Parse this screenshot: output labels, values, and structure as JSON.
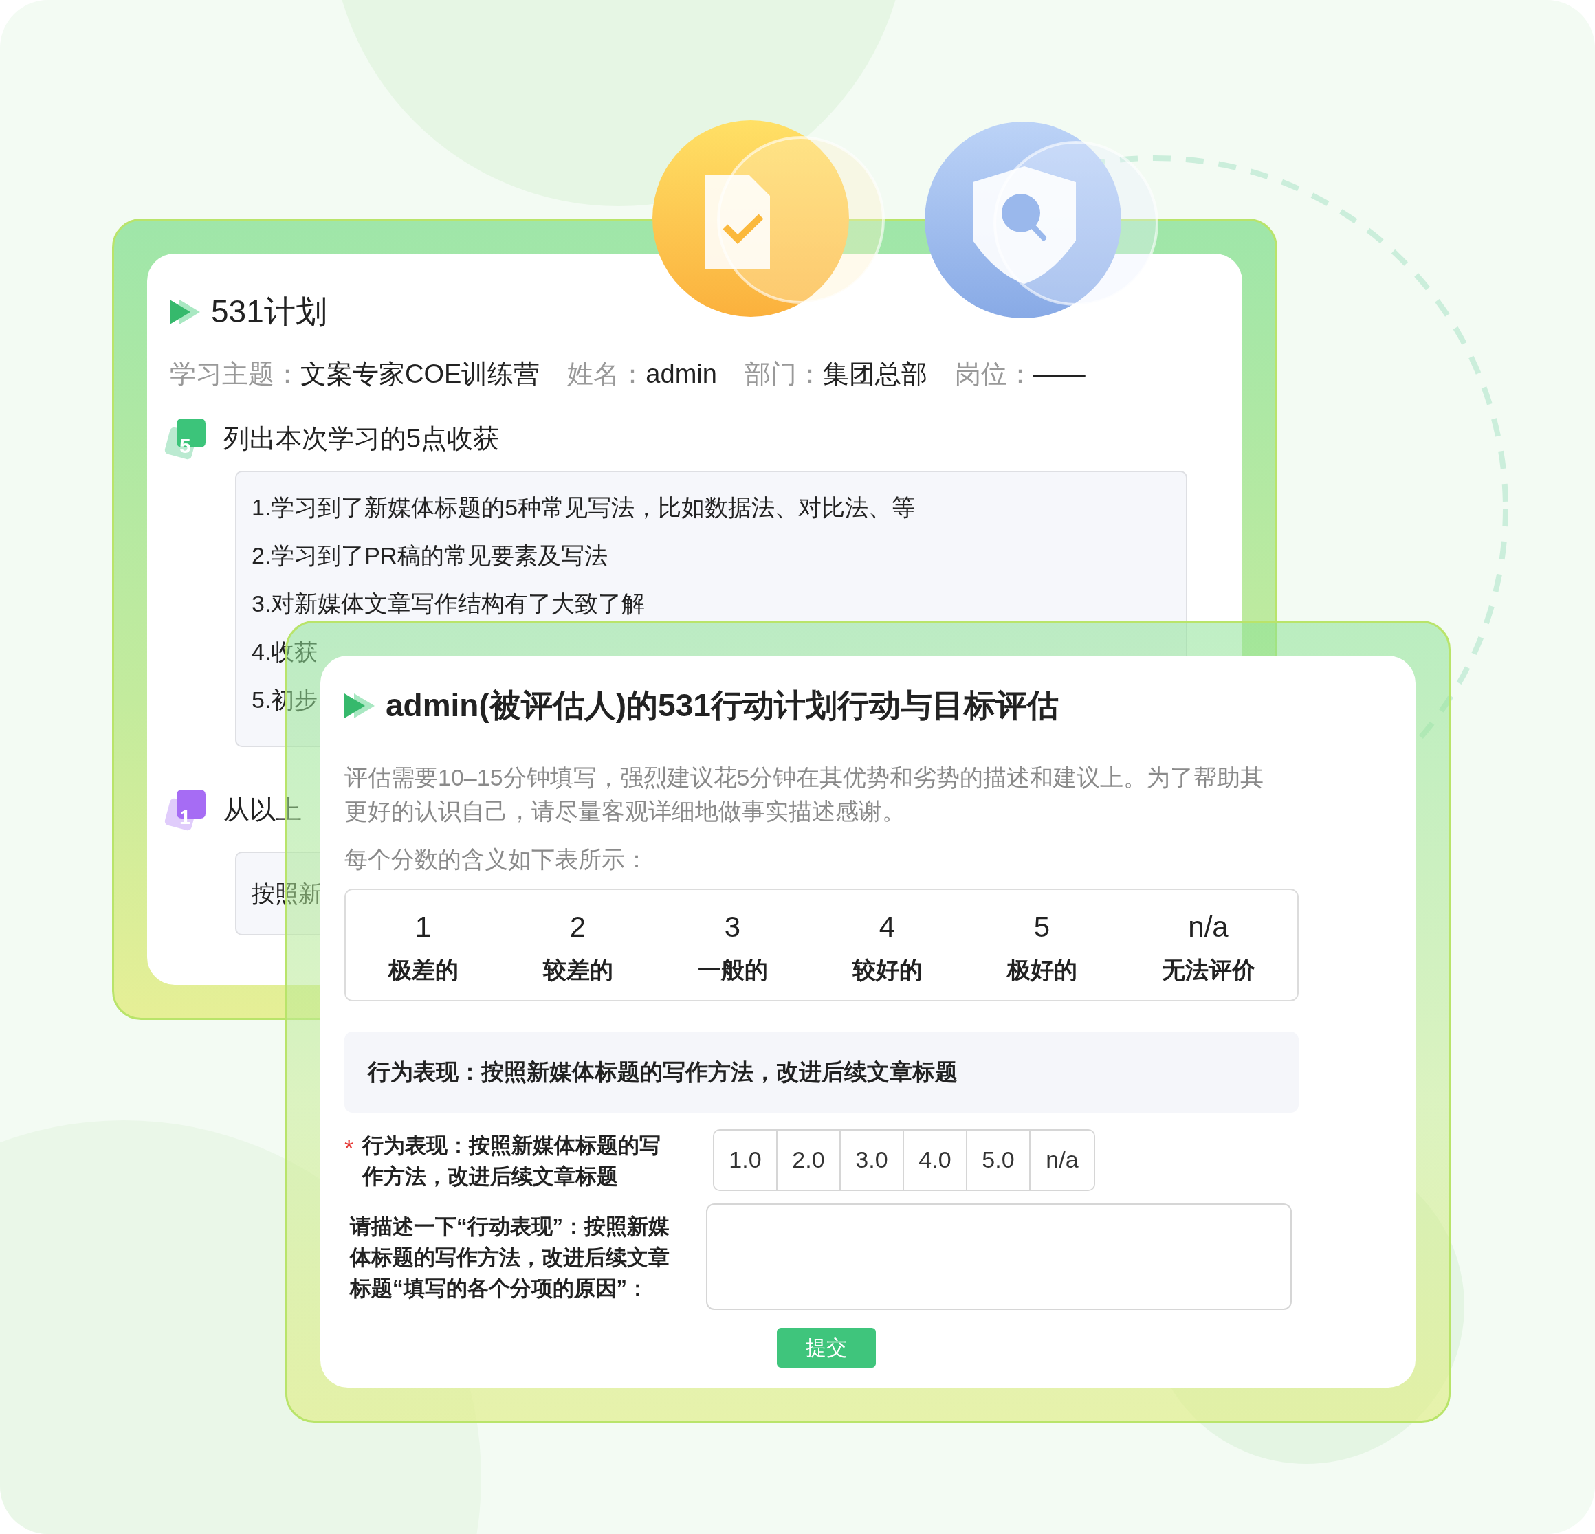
{
  "back_card": {
    "title": "531计划",
    "info": [
      {
        "label": "学习主题：",
        "value": "文案专家COE训练营"
      },
      {
        "label": "姓名：",
        "value": "admin"
      },
      {
        "label": "部门：",
        "value": "集团总部"
      },
      {
        "label": "岗位：",
        "value": "——"
      }
    ],
    "sections": [
      {
        "badge": "5",
        "color": "#3cc47a",
        "heading": "列出本次学习的5点收获",
        "lines": [
          "1.学习到了新媒体标题的5种常见写法，比如数据法、对比法、等",
          "2.学习到了PR稿的常见要素及写法",
          "3.对新媒体文章写作结构有了大致了解",
          "4.收获",
          "5.初步"
        ]
      },
      {
        "badge": "1",
        "color": "#a66cf4",
        "heading": "从以上",
        "lines": [
          "按照新"
        ]
      }
    ]
  },
  "front_card": {
    "title": "admin(被评估人)的531行动计划行动与目标评估",
    "intro": "评估需要10–15分钟填写，强烈建议花5分钟在其优势和劣势的描述和建议上。为了帮助其更好的认识自己，请尽量客观详细地做事实描述感谢。",
    "scale_caption": "每个分数的含义如下表所示：",
    "scale": [
      {
        "score": "1",
        "meaning": "极差的"
      },
      {
        "score": "2",
        "meaning": "较差的"
      },
      {
        "score": "3",
        "meaning": "一般的"
      },
      {
        "score": "4",
        "meaning": "较好的"
      },
      {
        "score": "5",
        "meaning": "极好的"
      },
      {
        "score": "n/a",
        "meaning": "无法评价"
      }
    ],
    "behavior": "行为表现：按照新媒体标题的写作方法，改进后续文章标题",
    "rating": {
      "required": true,
      "required_mark": "*",
      "label": "行为表现：按照新媒体标题的写作方法，改进后续文章标题",
      "options": [
        {
          "label": "1.0",
          "selected": false
        },
        {
          "label": "2.0",
          "selected": false
        },
        {
          "label": "3.0",
          "selected": false
        },
        {
          "label": "4.0",
          "selected": false
        },
        {
          "label": "5.0",
          "selected": false
        },
        {
          "label": "n/a",
          "selected": false
        }
      ]
    },
    "reason": {
      "label": "请描述一下“行动表现”：按照新媒体标题的写作方法，改进后续文章标题“填写的各个分项的原因”："
    },
    "submit": "提交"
  }
}
